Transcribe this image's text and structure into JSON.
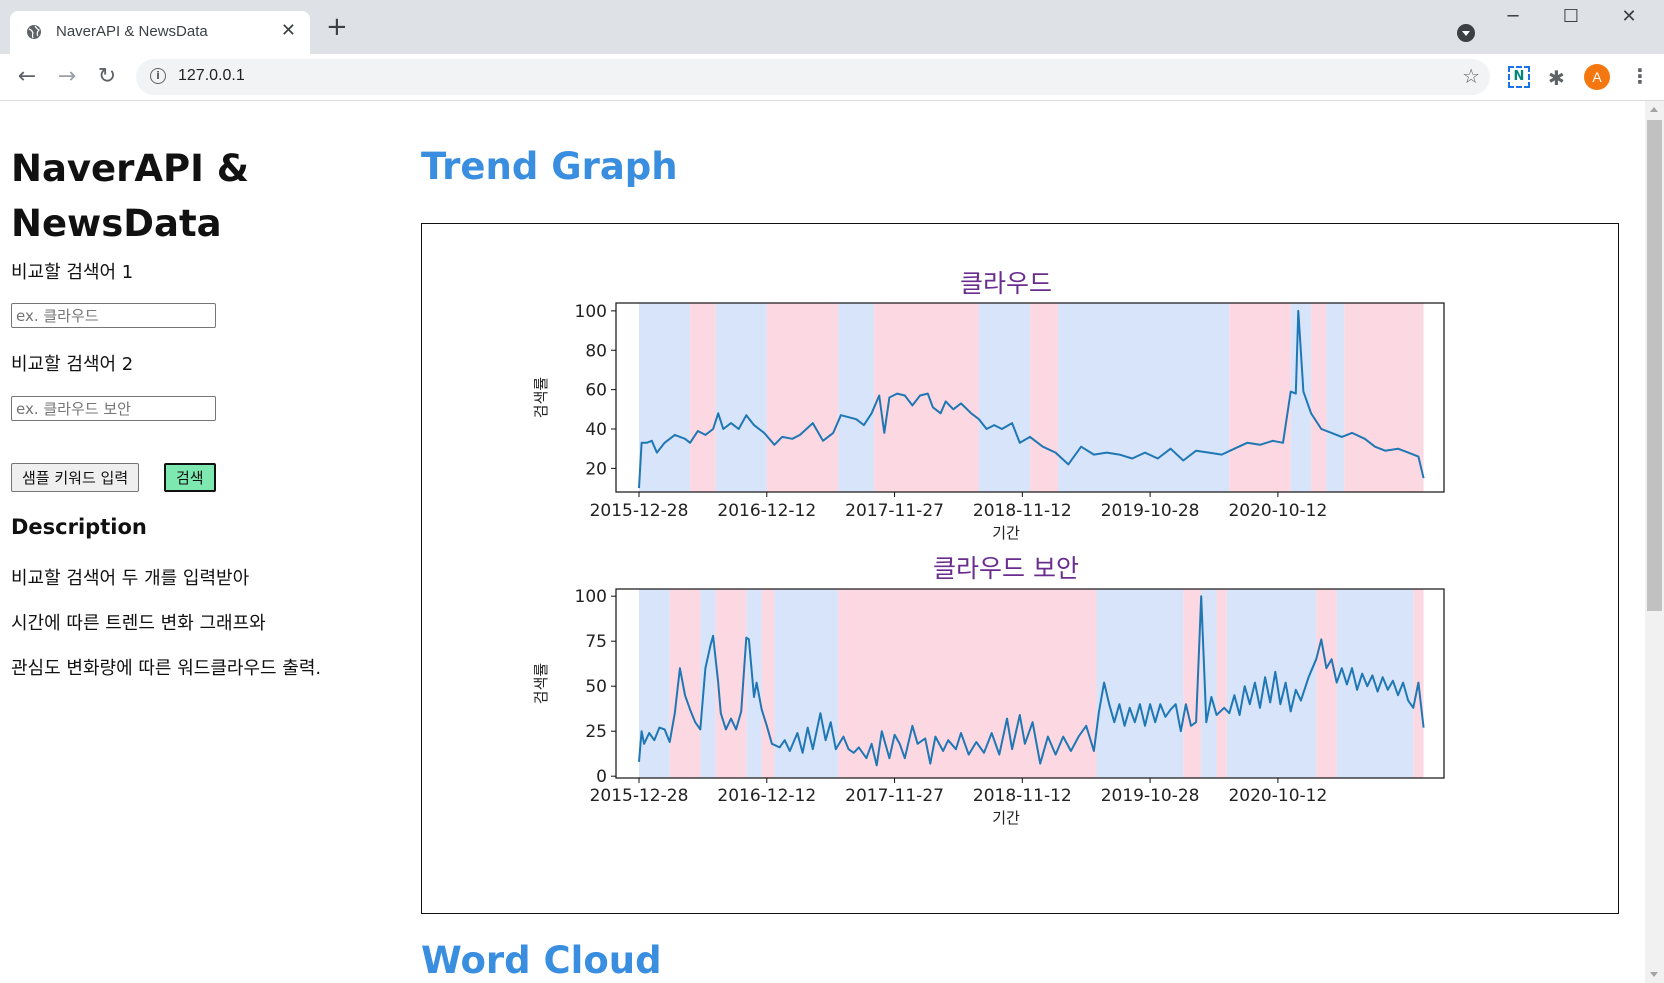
{
  "browser": {
    "tab_title": "NaverAPI & NewsData",
    "url": "127.0.0.1",
    "avatar_letter": "A",
    "ext_label": "N"
  },
  "sidebar": {
    "heading_line1": "NaverAPI &",
    "heading_line2": "NewsData",
    "label1": "비교할 검색어 1",
    "input1_placeholder": "ex. 클라우드",
    "label2": "비교할 검색어 2",
    "input2_placeholder": "ex. 클라우드 보안",
    "sample_button": "샘플 키워드 입력",
    "search_button": "검색",
    "desc_title": "Description",
    "desc_lines": [
      "비교할 검색어 두 개를 입력받아",
      "시간에 따른 트렌드 변화 그래프와",
      "관심도 변화량에 따른 워드클라우드 출력."
    ]
  },
  "main": {
    "trend_title": "Trend Graph",
    "wordcloud_title": "Word Cloud"
  },
  "chart_data": [
    {
      "type": "line",
      "title": "클라우드",
      "xlabel": "기간",
      "ylabel": "검색률",
      "x_ticks": [
        "2015-12-28",
        "2016-12-12",
        "2017-11-27",
        "2018-11-12",
        "2019-10-28",
        "2020-10-12"
      ],
      "y_ticks": [
        20,
        40,
        60,
        80,
        100
      ],
      "ylim": [
        8,
        104
      ],
      "xlim": [
        "2015-10-26",
        "2022-01-10"
      ],
      "series_color": "#1f77b4",
      "band_colors": {
        "increase": "#d7e4fa",
        "decrease": "#fbd8e2"
      },
      "bands": [
        {
          "from": "2015-12-28",
          "to": "2016-05-16",
          "kind": "increase"
        },
        {
          "from": "2016-05-16",
          "to": "2016-07-25",
          "kind": "decrease"
        },
        {
          "from": "2016-07-25",
          "to": "2016-12-12",
          "kind": "increase"
        },
        {
          "from": "2016-12-12",
          "to": "2017-06-26",
          "kind": "decrease"
        },
        {
          "from": "2017-06-26",
          "to": "2017-10-02",
          "kind": "increase"
        },
        {
          "from": "2017-10-02",
          "to": "2018-07-16",
          "kind": "decrease"
        },
        {
          "from": "2018-07-16",
          "to": "2018-12-03",
          "kind": "increase"
        },
        {
          "from": "2018-12-03",
          "to": "2019-02-18",
          "kind": "decrease"
        },
        {
          "from": "2019-02-18",
          "to": "2020-06-01",
          "kind": "increase"
        },
        {
          "from": "2020-06-01",
          "to": "2020-11-16",
          "kind": "decrease"
        },
        {
          "from": "2020-11-16",
          "to": "2021-01-11",
          "kind": "increase"
        },
        {
          "from": "2021-01-11",
          "to": "2021-02-22",
          "kind": "decrease"
        },
        {
          "from": "2021-02-22",
          "to": "2021-04-12",
          "kind": "increase"
        },
        {
          "from": "2021-04-12",
          "to": "2021-11-15",
          "kind": "decrease"
        }
      ],
      "points": [
        [
          "2015-12-28",
          10
        ],
        [
          "2016-01-04",
          33
        ],
        [
          "2016-01-18",
          33
        ],
        [
          "2016-02-01",
          34
        ],
        [
          "2016-02-15",
          28
        ],
        [
          "2016-03-07",
          33
        ],
        [
          "2016-04-04",
          37
        ],
        [
          "2016-05-02",
          35
        ],
        [
          "2016-05-16",
          33
        ],
        [
          "2016-06-06",
          39
        ],
        [
          "2016-06-27",
          37
        ],
        [
          "2016-07-18",
          40
        ],
        [
          "2016-08-01",
          48
        ],
        [
          "2016-08-15",
          40
        ],
        [
          "2016-09-05",
          43
        ],
        [
          "2016-09-26",
          40
        ],
        [
          "2016-10-17",
          47
        ],
        [
          "2016-11-07",
          42
        ],
        [
          "2016-12-05",
          38
        ],
        [
          "2017-01-02",
          32
        ],
        [
          "2017-01-23",
          36
        ],
        [
          "2017-02-20",
          35
        ],
        [
          "2017-03-13",
          37
        ],
        [
          "2017-04-17",
          43
        ],
        [
          "2017-05-15",
          34
        ],
        [
          "2017-06-12",
          38
        ],
        [
          "2017-07-03",
          47
        ],
        [
          "2017-07-24",
          46
        ],
        [
          "2017-08-14",
          45
        ],
        [
          "2017-09-04",
          42
        ],
        [
          "2017-09-25",
          48
        ],
        [
          "2017-10-16",
          57
        ],
        [
          "2017-10-30",
          38
        ],
        [
          "2017-11-13",
          56
        ],
        [
          "2017-12-04",
          58
        ],
        [
          "2017-12-25",
          57
        ],
        [
          "2018-01-15",
          52
        ],
        [
          "2018-02-05",
          57
        ],
        [
          "2018-02-26",
          58
        ],
        [
          "2018-03-12",
          51
        ],
        [
          "2018-04-02",
          48
        ],
        [
          "2018-04-16",
          54
        ],
        [
          "2018-05-07",
          50
        ],
        [
          "2018-05-28",
          53
        ],
        [
          "2018-06-25",
          48
        ],
        [
          "2018-07-16",
          45
        ],
        [
          "2018-08-06",
          40
        ],
        [
          "2018-08-27",
          42
        ],
        [
          "2018-09-17",
          40
        ],
        [
          "2018-10-15",
          43
        ],
        [
          "2018-11-05",
          33
        ],
        [
          "2018-12-03",
          36
        ],
        [
          "2019-01-07",
          31
        ],
        [
          "2019-02-11",
          28
        ],
        [
          "2019-03-18",
          22
        ],
        [
          "2019-04-22",
          31
        ],
        [
          "2019-05-27",
          27
        ],
        [
          "2019-07-01",
          28
        ],
        [
          "2019-08-05",
          27
        ],
        [
          "2019-09-09",
          25
        ],
        [
          "2019-10-14",
          28
        ],
        [
          "2019-11-18",
          25
        ],
        [
          "2019-12-23",
          30
        ],
        [
          "2020-01-27",
          24
        ],
        [
          "2020-03-02",
          29
        ],
        [
          "2020-04-06",
          28
        ],
        [
          "2020-05-11",
          27
        ],
        [
          "2020-06-15",
          30
        ],
        [
          "2020-07-20",
          33
        ],
        [
          "2020-08-24",
          32
        ],
        [
          "2020-09-28",
          34
        ],
        [
          "2020-10-26",
          33
        ],
        [
          "2020-11-16",
          59
        ],
        [
          "2020-11-30",
          58
        ],
        [
          "2020-12-07",
          100
        ],
        [
          "2020-12-21",
          59
        ],
        [
          "2021-01-11",
          48
        ],
        [
          "2021-02-08",
          40
        ],
        [
          "2021-03-08",
          38
        ],
        [
          "2021-04-05",
          36
        ],
        [
          "2021-05-03",
          38
        ],
        [
          "2021-06-07",
          35
        ],
        [
          "2021-07-05",
          31
        ],
        [
          "2021-08-02",
          29
        ],
        [
          "2021-09-06",
          30
        ],
        [
          "2021-10-04",
          28
        ],
        [
          "2021-11-01",
          26
        ],
        [
          "2021-11-15",
          15
        ]
      ]
    },
    {
      "type": "line",
      "title": "클라우드 보안",
      "xlabel": "기간",
      "ylabel": "검색률",
      "x_ticks": [
        "2015-12-28",
        "2016-12-12",
        "2017-11-27",
        "2018-11-12",
        "2019-10-28",
        "2020-10-12"
      ],
      "y_ticks": [
        0,
        25,
        50,
        75,
        100
      ],
      "ylim": [
        -1,
        104
      ],
      "xlim": [
        "2015-10-26",
        "2022-01-10"
      ],
      "series_color": "#1f77b4",
      "band_colors": {
        "increase": "#d7e4fa",
        "decrease": "#fbd8e2"
      },
      "bands": [
        {
          "from": "2015-12-28",
          "to": "2016-03-21",
          "kind": "increase"
        },
        {
          "from": "2016-03-21",
          "to": "2016-06-13",
          "kind": "decrease"
        },
        {
          "from": "2016-06-13",
          "to": "2016-07-25",
          "kind": "increase"
        },
        {
          "from": "2016-07-25",
          "to": "2016-10-17",
          "kind": "decrease"
        },
        {
          "from": "2016-10-17",
          "to": "2016-11-28",
          "kind": "increase"
        },
        {
          "from": "2016-11-28",
          "to": "2017-01-02",
          "kind": "decrease"
        },
        {
          "from": "2017-01-02",
          "to": "2017-06-26",
          "kind": "increase"
        },
        {
          "from": "2017-06-26",
          "to": "2019-06-03",
          "kind": "decrease"
        },
        {
          "from": "2019-06-03",
          "to": "2020-01-27",
          "kind": "increase"
        },
        {
          "from": "2020-01-27",
          "to": "2020-03-16",
          "kind": "decrease"
        },
        {
          "from": "2020-03-16",
          "to": "2020-04-27",
          "kind": "increase"
        },
        {
          "from": "2020-04-27",
          "to": "2020-05-25",
          "kind": "decrease"
        },
        {
          "from": "2020-05-25",
          "to": "2021-01-25",
          "kind": "increase"
        },
        {
          "from": "2021-01-25",
          "to": "2021-03-22",
          "kind": "decrease"
        },
        {
          "from": "2021-03-22",
          "to": "2021-10-18",
          "kind": "increase"
        },
        {
          "from": "2021-10-18",
          "to": "2021-11-15",
          "kind": "decrease"
        }
      ],
      "points": [
        [
          "2015-12-28",
          8
        ],
        [
          "2016-01-04",
          25
        ],
        [
          "2016-01-11",
          18
        ],
        [
          "2016-01-25",
          24
        ],
        [
          "2016-02-08",
          20
        ],
        [
          "2016-02-22",
          27
        ],
        [
          "2016-03-07",
          26
        ],
        [
          "2016-03-21",
          19
        ],
        [
          "2016-04-04",
          35
        ],
        [
          "2016-04-18",
          60
        ],
        [
          "2016-05-02",
          45
        ],
        [
          "2016-05-16",
          37
        ],
        [
          "2016-05-30",
          30
        ],
        [
          "2016-06-13",
          26
        ],
        [
          "2016-06-27",
          60
        ],
        [
          "2016-07-11",
          73
        ],
        [
          "2016-07-18",
          78
        ],
        [
          "2016-08-01",
          52
        ],
        [
          "2016-08-08",
          35
        ],
        [
          "2016-08-22",
          26
        ],
        [
          "2016-09-05",
          32
        ],
        [
          "2016-09-19",
          26
        ],
        [
          "2016-10-03",
          36
        ],
        [
          "2016-10-17",
          77
        ],
        [
          "2016-10-24",
          76
        ],
        [
          "2016-11-07",
          44
        ],
        [
          "2016-11-14",
          52
        ],
        [
          "2016-11-28",
          37
        ],
        [
          "2016-12-12",
          28
        ],
        [
          "2016-12-26",
          18
        ],
        [
          "2017-01-16",
          16
        ],
        [
          "2017-01-30",
          20
        ],
        [
          "2017-02-13",
          14
        ],
        [
          "2017-03-06",
          24
        ],
        [
          "2017-03-20",
          13
        ],
        [
          "2017-04-03",
          27
        ],
        [
          "2017-04-17",
          15
        ],
        [
          "2017-05-08",
          35
        ],
        [
          "2017-05-22",
          20
        ],
        [
          "2017-06-05",
          30
        ],
        [
          "2017-06-19",
          15
        ],
        [
          "2017-07-10",
          22
        ],
        [
          "2017-07-24",
          15
        ],
        [
          "2017-08-07",
          13
        ],
        [
          "2017-08-21",
          16
        ],
        [
          "2017-09-11",
          10
        ],
        [
          "2017-09-25",
          18
        ],
        [
          "2017-10-09",
          6
        ],
        [
          "2017-10-23",
          25
        ],
        [
          "2017-11-13",
          10
        ],
        [
          "2017-11-27",
          23
        ],
        [
          "2017-12-11",
          18
        ],
        [
          "2017-12-25",
          10
        ],
        [
          "2018-01-15",
          28
        ],
        [
          "2018-01-29",
          18
        ],
        [
          "2018-02-19",
          21
        ],
        [
          "2018-03-05",
          7
        ],
        [
          "2018-03-19",
          22
        ],
        [
          "2018-04-09",
          14
        ],
        [
          "2018-04-23",
          20
        ],
        [
          "2018-05-14",
          15
        ],
        [
          "2018-05-28",
          24
        ],
        [
          "2018-06-18",
          12
        ],
        [
          "2018-07-09",
          19
        ],
        [
          "2018-07-30",
          13
        ],
        [
          "2018-08-20",
          24
        ],
        [
          "2018-09-10",
          12
        ],
        [
          "2018-10-01",
          32
        ],
        [
          "2018-10-15",
          15
        ],
        [
          "2018-11-05",
          34
        ],
        [
          "2018-11-19",
          18
        ],
        [
          "2018-12-10",
          30
        ],
        [
          "2018-12-31",
          7
        ],
        [
          "2019-01-21",
          22
        ],
        [
          "2019-02-11",
          12
        ],
        [
          "2019-03-04",
          22
        ],
        [
          "2019-03-25",
          14
        ],
        [
          "2019-04-15",
          22
        ],
        [
          "2019-05-06",
          28
        ],
        [
          "2019-05-27",
          14
        ],
        [
          "2019-06-10",
          36
        ],
        [
          "2019-06-24",
          52
        ],
        [
          "2019-07-08",
          40
        ],
        [
          "2019-07-22",
          30
        ],
        [
          "2019-08-05",
          40
        ],
        [
          "2019-08-19",
          28
        ],
        [
          "2019-09-02",
          38
        ],
        [
          "2019-09-16",
          30
        ],
        [
          "2019-09-30",
          40
        ],
        [
          "2019-10-14",
          28
        ],
        [
          "2019-10-28",
          40
        ],
        [
          "2019-11-11",
          30
        ],
        [
          "2019-11-25",
          40
        ],
        [
          "2019-12-09",
          33
        ],
        [
          "2019-12-23",
          37
        ],
        [
          "2020-01-06",
          40
        ],
        [
          "2020-01-20",
          25
        ],
        [
          "2020-02-03",
          40
        ],
        [
          "2020-02-17",
          28
        ],
        [
          "2020-03-02",
          30
        ],
        [
          "2020-03-16",
          100
        ],
        [
          "2020-03-30",
          30
        ],
        [
          "2020-04-13",
          44
        ],
        [
          "2020-04-27",
          34
        ],
        [
          "2020-05-18",
          38
        ],
        [
          "2020-06-01",
          35
        ],
        [
          "2020-06-15",
          45
        ],
        [
          "2020-06-29",
          34
        ],
        [
          "2020-07-13",
          50
        ],
        [
          "2020-07-27",
          40
        ],
        [
          "2020-08-10",
          52
        ],
        [
          "2020-08-24",
          38
        ],
        [
          "2020-09-07",
          55
        ],
        [
          "2020-09-21",
          41
        ],
        [
          "2020-10-05",
          58
        ],
        [
          "2020-10-19",
          40
        ],
        [
          "2020-11-02",
          52
        ],
        [
          "2020-11-16",
          36
        ],
        [
          "2020-11-30",
          48
        ],
        [
          "2020-12-14",
          42
        ],
        [
          "2021-01-04",
          55
        ],
        [
          "2021-01-25",
          65
        ],
        [
          "2021-02-08",
          76
        ],
        [
          "2021-02-22",
          60
        ],
        [
          "2021-03-08",
          65
        ],
        [
          "2021-03-22",
          52
        ],
        [
          "2021-04-05",
          60
        ],
        [
          "2021-04-19",
          51
        ],
        [
          "2021-05-03",
          60
        ],
        [
          "2021-05-17",
          48
        ],
        [
          "2021-05-31",
          57
        ],
        [
          "2021-06-14",
          50
        ],
        [
          "2021-06-28",
          56
        ],
        [
          "2021-07-12",
          47
        ],
        [
          "2021-07-26",
          55
        ],
        [
          "2021-08-09",
          48
        ],
        [
          "2021-08-23",
          53
        ],
        [
          "2021-09-06",
          45
        ],
        [
          "2021-09-20",
          52
        ],
        [
          "2021-10-04",
          42
        ],
        [
          "2021-10-18",
          38
        ],
        [
          "2021-11-01",
          52
        ],
        [
          "2021-11-15",
          27
        ]
      ]
    }
  ]
}
